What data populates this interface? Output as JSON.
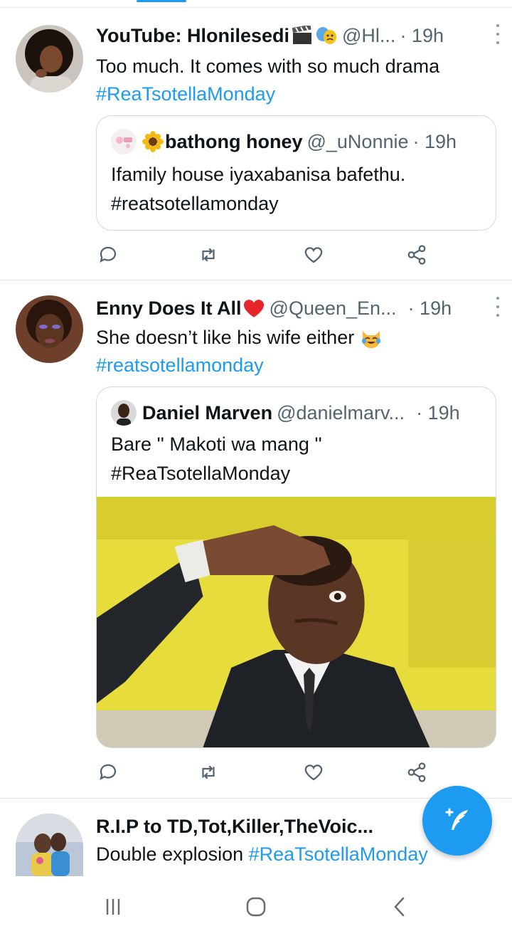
{
  "tweets": [
    {
      "name": "YouTube: Hlonilesedi",
      "handle": "@Hl...",
      "time": "· 19h",
      "text": "Too much. It comes with so much drama",
      "hashtag": "#ReaTsotellaMonday",
      "quote": {
        "name": "bathong honey",
        "handle": "@_uNonnie",
        "time": "· 19h",
        "line1": "Ifamily house iyaxabanisa bafethu.",
        "line2": "#reatsotellamonday"
      }
    },
    {
      "name": "Enny Does It All",
      "handle": "@Queen_En...",
      "time": "· 19h",
      "text": "She doesn’t like his wife either",
      "hashtag": "#reatsotellamonday",
      "quote": {
        "name": "Daniel Marven",
        "handle": "@danielmarv...",
        "time": "· 19h",
        "line1": "Bare '' Makoti wa mang ''",
        "line2": "#ReaTsotellaMonday",
        "image_alt": "man-shielding-eyes-photo"
      }
    },
    {
      "name": "R.I.P to TD,Tot,Killer,TheVoic...",
      "text": "Double explosion",
      "hashtag": "#ReaTsotellaMonday"
    }
  ],
  "icons": {
    "reply": "reply-icon",
    "retweet": "retweet-icon",
    "like": "heart-icon",
    "share": "share-icon",
    "more": "more-dots-icon",
    "compose": "compose-tweet-icon"
  },
  "colors": {
    "accent": "#1d9bf0",
    "text": "#0f1419",
    "secondary": "#536471",
    "border": "#cfd9de"
  }
}
